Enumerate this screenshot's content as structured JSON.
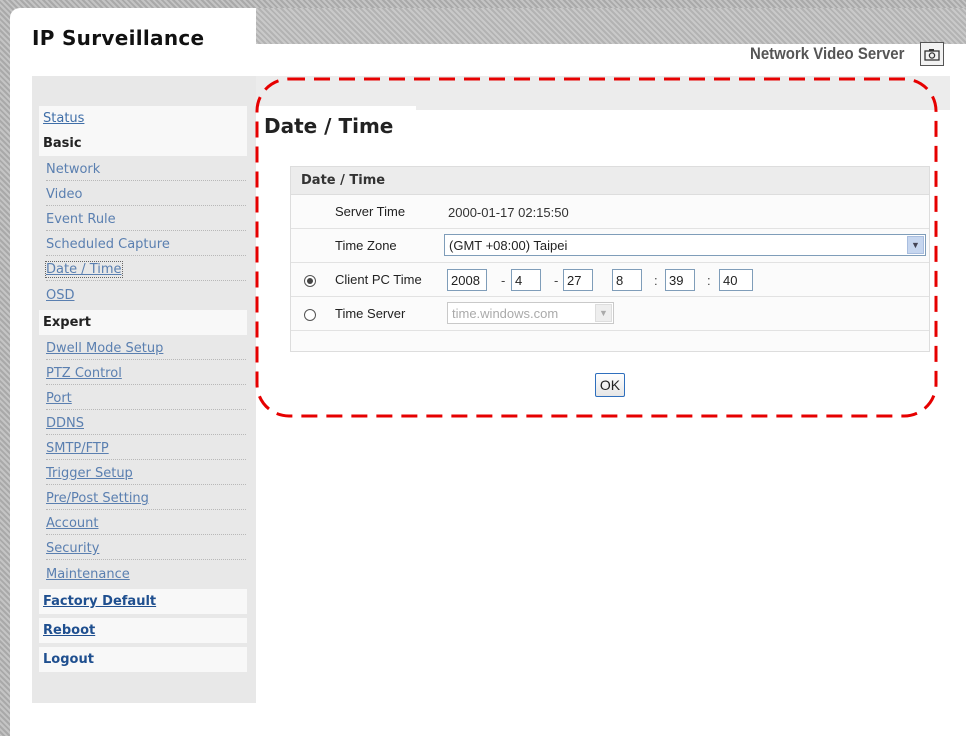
{
  "header": {
    "brand": "IP Surveillance",
    "product": "Network Video Server",
    "camera_button_icon": "camera-icon"
  },
  "sidebar": {
    "status": "Status",
    "basic": {
      "label": "Basic",
      "items": [
        "Network",
        "Video",
        "Event Rule",
        "Scheduled Capture",
        "Date / Time",
        "OSD"
      ]
    },
    "expert": {
      "label": "Expert",
      "items": [
        "Dwell Mode Setup",
        "PTZ Control",
        "Port",
        "DDNS",
        "SMTP/FTP",
        "Trigger Setup",
        "Pre/Post Setting",
        "Account",
        "Security",
        "Maintenance"
      ]
    },
    "factory_default": "Factory Default",
    "reboot": "Reboot",
    "logout": "Logout"
  },
  "page": {
    "title": "Date / Time",
    "panel_title": "Date / Time",
    "server_time_label": "Server Time",
    "server_time_value": "2000-01-17 02:15:50",
    "time_zone_label": "Time Zone",
    "time_zone_value": "(GMT +08:00) Taipei",
    "client_pc_label": "Client PC Time",
    "client_pc_selected": true,
    "client": {
      "year": "2008",
      "month": "4",
      "day": "27",
      "hour": "8",
      "minute": "39",
      "second": "40",
      "date_sep": "-",
      "time_sep": ":"
    },
    "time_server_label": "Time Server",
    "time_server_value": "time.windows.com",
    "ok_label": "OK"
  },
  "colors": {
    "annotation_border": "#e60000",
    "link": "#3f6ea8",
    "sidebar_bg": "#e8e8e8"
  }
}
